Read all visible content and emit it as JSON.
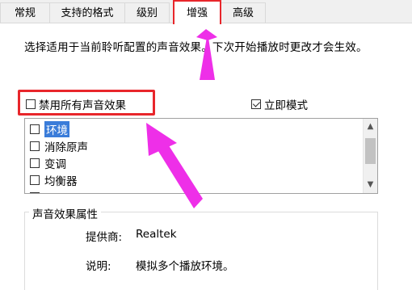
{
  "tabs": [
    {
      "label": "常规",
      "active": false
    },
    {
      "label": "支持的格式",
      "active": false
    },
    {
      "label": "级别",
      "active": false
    },
    {
      "label": "增强",
      "active": true
    },
    {
      "label": "高级",
      "active": false
    }
  ],
  "description": "选择适用于当前聆听配置的声音效果。下次开始播放时更改才会生效。",
  "disable_all": {
    "label": "禁用所有声音效果",
    "checked": false
  },
  "immediate_mode": {
    "label": "立即模式",
    "checked": true
  },
  "effects": [
    {
      "label": "环境",
      "checked": false,
      "selected": true
    },
    {
      "label": "消除原声",
      "checked": false,
      "selected": false
    },
    {
      "label": "变调",
      "checked": false,
      "selected": false
    },
    {
      "label": "均衡器",
      "checked": false,
      "selected": false
    }
  ],
  "properties": {
    "group_title": "声音效果属性",
    "provider_label": "提供商:",
    "provider_value": "Realtek",
    "description_label": "说明:",
    "description_value": "模拟多个播放环境。"
  },
  "colors": {
    "highlight_red": "#e8262b",
    "arrow_magenta": "#ee2fe8",
    "selection_blue": "#3a7cd9"
  }
}
